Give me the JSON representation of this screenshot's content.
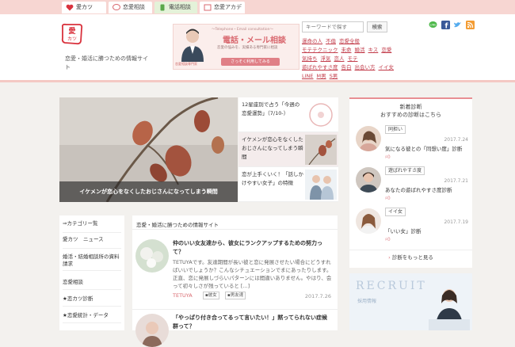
{
  "tabs": [
    {
      "label": "愛カツ"
    },
    {
      "label": "恋愛相談"
    },
    {
      "label": "電話相談"
    },
    {
      "label": "恋愛アカデミー"
    }
  ],
  "header": {
    "tagline": "恋愛・婚活に勝つための情報サイト",
    "search_placeholder": "キーワードで探す",
    "search_button": "検索",
    "banner": {
      "top": "〜Telephone・Email consultation〜",
      "title": "電話・メール相談",
      "sub": "恋愛の悩みを、実績ある専門家に相談",
      "button": "さっそく利用してみる",
      "caption": "恋愛相談専門家"
    },
    "links": [
      [
        "運命の人",
        "不倫",
        "恋愛全般"
      ],
      [
        "モテテクニック",
        "未命",
        "婚活",
        "キス",
        "恋愛"
      ],
      [
        "気持ち",
        "浮気",
        "恋人",
        "モテ"
      ],
      [
        "遊ばれやすさ度",
        "告白",
        "出会い方",
        "イイ女"
      ],
      [
        "LINE",
        "M男",
        "S男"
      ]
    ]
  },
  "slider": {
    "caption": "イケメンが恋心をなくしたおじさんになってしまう瞬間"
  },
  "side_items": [
    {
      "text": "12星座別で占う「今週の恋愛運勢」（7/10-）"
    },
    {
      "text": "イケメンが恋心をなくしたおじさんになってしまう瞬間"
    },
    {
      "text": "恋が上手くいく！「話しかけやすい女子」の特徴"
    }
  ],
  "right_panel": {
    "title": "新着診断",
    "subtitle": "おすすめの診断はこちら",
    "items": [
      {
        "tag": "同担い",
        "date": "2017.7.24",
        "title": "気になる彼との「同想い度」診断",
        "count": "♯0"
      },
      {
        "tag": "遊ばれやすさ度",
        "date": "2017.7.21",
        "title": "あなたの遊ばれやすさ度診断",
        "count": "♯0"
      },
      {
        "tag": "イイ女",
        "date": "2017.7.19",
        "title": "「いい女」診断",
        "count": "♯0"
      }
    ],
    "more": "診断をもっと見る"
  },
  "recruit": {
    "title": "RECRUIT",
    "sub": "採用情報"
  },
  "left_nav": [
    "⇒カテゴリー覧",
    "愛カツ　ニュース",
    "婚活・結婚相談所の資料請求",
    "恋愛相談",
    "★恋カツ診断",
    "★恋愛統計・データ"
  ],
  "main": {
    "heading": "恋愛・婚活に勝つための情報サイト",
    "posts": [
      {
        "title": "仲のいい女友達から、彼女にランクアップするための努力って？",
        "excerpt": "TETUYAです。友達期間が長い彼と恋に発展させたい場合にどうすればいいでしょうか？こんなシチュエーションでまにあったりします。正直、恋に発展しづらいパターンには間違いありません。やはり、会って初々しさが残っていると [...]",
        "author": "TETUYA",
        "tags": [
          "彼女",
          "男友達"
        ],
        "date": "2017.7.26"
      },
      {
        "title": "「やっぱり付き合ってるって言いたい！」黙ってられない症候群って？",
        "excerpt": "",
        "author": "",
        "tags": [],
        "date": ""
      }
    ]
  },
  "colors": {
    "accent": "#d9686f",
    "link": "#c23c4a",
    "topbar": "#f7d6d2"
  }
}
